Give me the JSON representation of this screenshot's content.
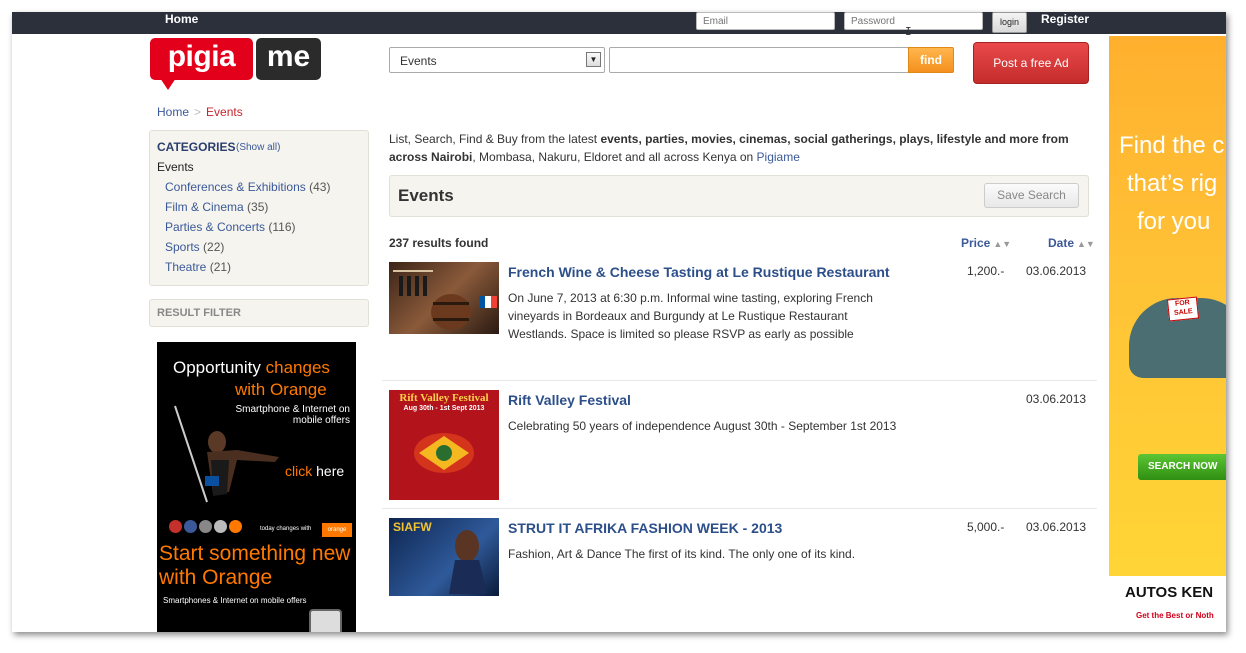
{
  "topbar": {
    "home": "Home",
    "email_placeholder": "Email",
    "password_placeholder": "Password",
    "login": "login",
    "register": "Register"
  },
  "logo": {
    "left": "pigia",
    "right": "me"
  },
  "breadcrumb": {
    "home": "Home",
    "separator": ">",
    "current": "Events"
  },
  "categories": {
    "title": "CATEGORIES",
    "show_all": "(Show all)",
    "current": "Events",
    "items": [
      {
        "label": "Conferences & Exhibitions",
        "count": "(43)"
      },
      {
        "label": "Film & Cinema",
        "count": "(35)"
      },
      {
        "label": "Parties & Concerts",
        "count": "(116)"
      },
      {
        "label": "Sports",
        "count": "(22)"
      },
      {
        "label": "Theatre",
        "count": "(21)"
      }
    ]
  },
  "result_filter": "RESULT FILTER",
  "ad_left": {
    "line1a": "Opportunity",
    "line1b": "changes",
    "line2": "with Orange",
    "line3": "Smartphone & Internet on mobile offers",
    "click": "click",
    "here": "here",
    "today": "today changes with",
    "brand": "orange",
    "line4": "Start something new",
    "line5": "with Orange",
    "line6": "Smartphones & Internet on mobile offers"
  },
  "search": {
    "category": "Events",
    "query": "",
    "find": "find",
    "post_ad": "Post a free Ad"
  },
  "intro": {
    "p1": "List, Search, Find & Buy from the latest ",
    "bold": "events, parties, movies,  cinemas, social gatherings, plays, lifestyle and more from across Nairobi",
    "p2": ", Mombasa, Nakuru, Eldoret and all across Kenya on ",
    "link": "Pigiame"
  },
  "events_header": {
    "title": "Events",
    "save_search": "Save Search"
  },
  "list": {
    "results": "237 results found",
    "sort_price": "Price",
    "sort_date": "Date"
  },
  "listings": [
    {
      "title": "French Wine & Cheese Tasting at Le Rustique Restaurant",
      "desc": "On June 7, 2013 at 6:30 p.m. Informal wine tasting, exploring French vineyards in Bordeaux and Burgundy at Le Rustique Restaurant Westlands. Space is limited so please RSVP as early as possible",
      "price": "1,200.-",
      "date": "03.06.2013"
    },
    {
      "title": "Rift Valley Festival",
      "desc": "Celebrating 50 years of independence August 30th - September 1st 2013",
      "price": "",
      "date": "03.06.2013",
      "thumb_title": "Rift Valley Festival",
      "thumb_sub": "Aug 30th - 1st Sept 2013"
    },
    {
      "title": "STRUT IT AFRIKA FASHION WEEK - 2013",
      "desc": "Fashion, Art & Dance The first of its kind. The only one of its kind.",
      "price": "5,000.-",
      "date": "03.06.2013",
      "thumb_title": "SIAFW"
    }
  ],
  "ad_right": {
    "t1": "Find the c",
    "t2": "that’s rig",
    "t3": "for you",
    "for_sale": "FOR SALE",
    "search_now": "SEARCH NOW",
    "autos": "AUTOS KEN",
    "tagline": "Get the Best or Noth"
  },
  "colors": {
    "topbar": "#2b303b",
    "brand_red": "#e2001a",
    "link_blue": "#3b5998",
    "find_orange": "#f4901e",
    "orange_brand": "#ff7900"
  }
}
